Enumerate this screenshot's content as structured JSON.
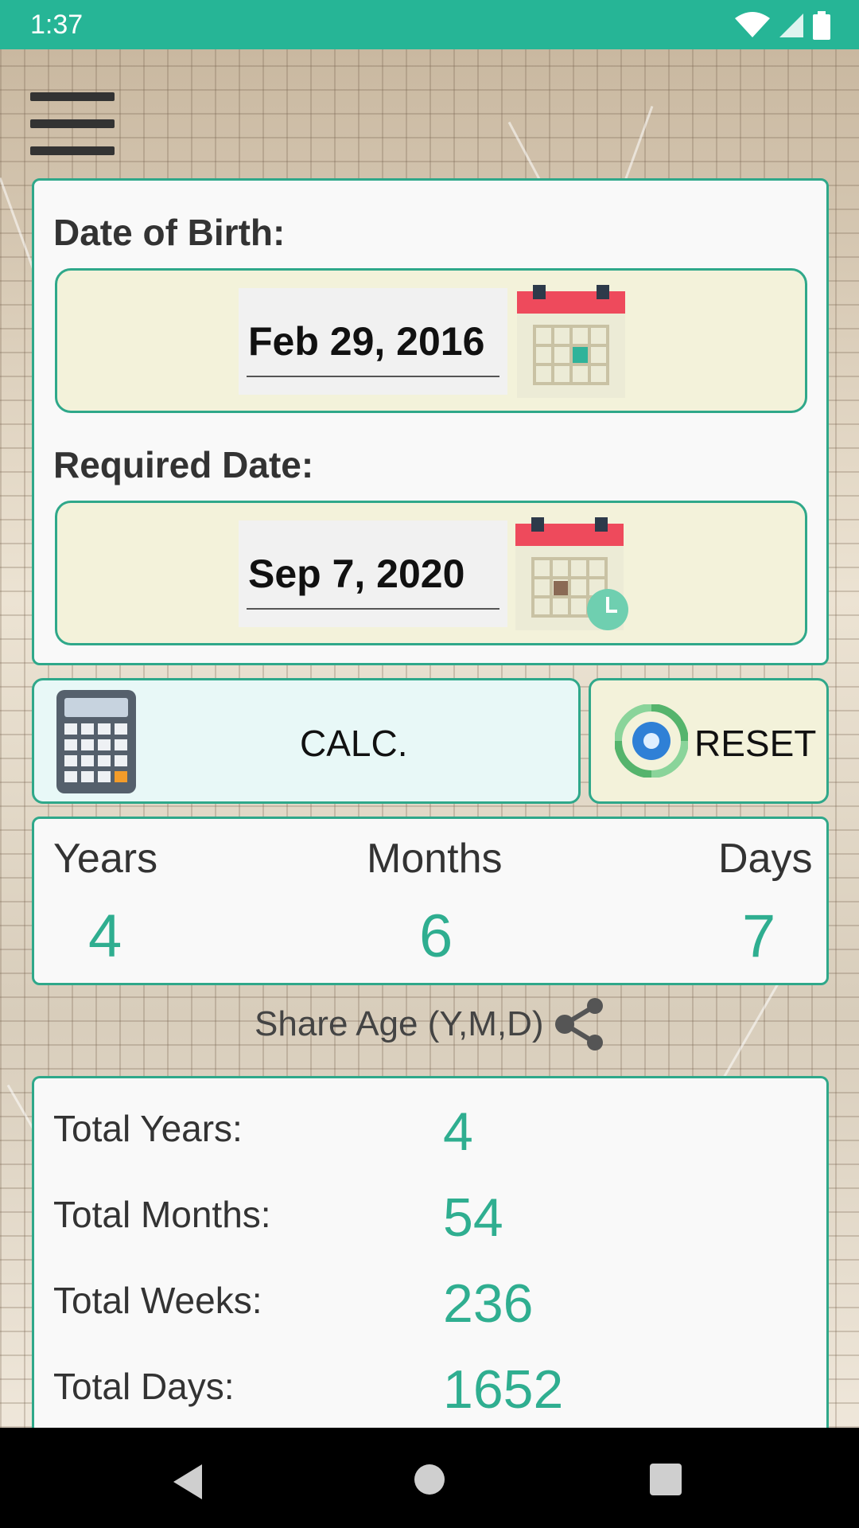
{
  "status_bar": {
    "time": "1:37"
  },
  "dob": {
    "label": "Date of Birth:",
    "value": "Feb 29, 2016"
  },
  "required": {
    "label": "Required Date:",
    "value": "Sep 7, 2020"
  },
  "buttons": {
    "calc": "CALC.",
    "reset": "RESET"
  },
  "result": {
    "years_label": "Years",
    "months_label": "Months",
    "days_label": "Days",
    "years": "4",
    "months": "6",
    "days": "7"
  },
  "share_label": "Share Age (Y,M,D)",
  "totals": [
    {
      "label": "Total Years:",
      "value": "4"
    },
    {
      "label": "Total Months:",
      "value": "54"
    },
    {
      "label": "Total Weeks:",
      "value": "236"
    },
    {
      "label": "Total Days:",
      "value": "1652"
    }
  ],
  "colors": {
    "accent": "#26b596",
    "value": "#2fae90",
    "field_bg": "#f3f2da",
    "calc_bg": "#e8f8f7"
  },
  "icons": [
    "menu-icon",
    "calendar-icon",
    "calendar-clock-icon",
    "calculator-icon",
    "reset-gear-icon",
    "share-icon",
    "wifi-icon",
    "signal-icon",
    "battery-icon",
    "back-nav-icon",
    "home-nav-icon",
    "recents-nav-icon"
  ]
}
